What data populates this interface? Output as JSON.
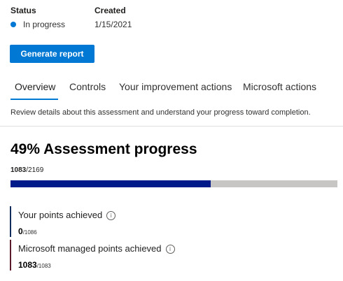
{
  "status": {
    "label": "Status",
    "value": "In progress",
    "dot_color": "#0078d4"
  },
  "created": {
    "label": "Created",
    "value": "1/15/2021"
  },
  "generate_button": "Generate report",
  "tabs": [
    {
      "label": "Overview",
      "active": true
    },
    {
      "label": "Controls",
      "active": false
    },
    {
      "label": "Your improvement actions",
      "active": false
    },
    {
      "label": "Microsoft actions",
      "active": false
    }
  ],
  "description": "Review details about this assessment and understand your progress toward completion.",
  "progress": {
    "title": "49% Assessment progress",
    "achieved": "1083",
    "total": "/2169",
    "fraction": 0.49
  },
  "your_points": {
    "label": "Your points achieved",
    "value": "0",
    "total": "/1086",
    "accent_color": "#0f2c5c",
    "info_icon": "i"
  },
  "microsoft_points": {
    "label": "Microsoft managed points achieved",
    "value": "1083",
    "total": "/1083",
    "accent_color": "#5c1b2c",
    "info_icon": "i"
  }
}
